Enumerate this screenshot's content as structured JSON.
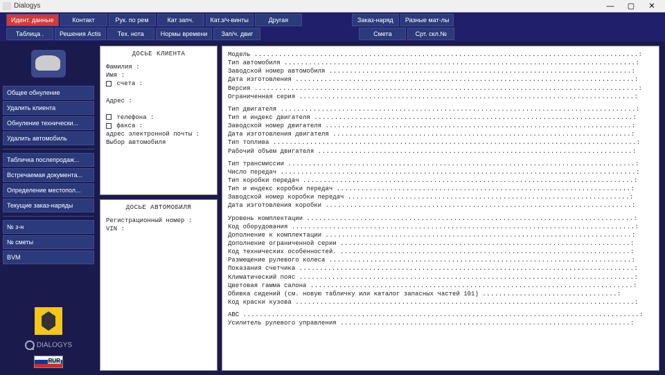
{
  "window": {
    "title": "Dialogys"
  },
  "topnav": {
    "row1": [
      "Идент. данные",
      "Контакт",
      "Рук. по рем",
      "Кат запч.",
      "Кат.з/ч-винты",
      "Другая",
      "",
      "Заказ-наряд",
      "Разные мат-лы"
    ],
    "row2": [
      "Таблица .",
      "Решения Actis",
      "Тех. нота",
      "Нормы времени",
      "Зап/ч. двиг",
      "",
      "",
      "Смета",
      "Срт. скл.№"
    ],
    "active_index": 0
  },
  "sidebar": {
    "group1": [
      "Общее обнуление",
      "Удалить клиента",
      "Обнуление технически...",
      "Удалить автомобиль"
    ],
    "group2": [
      "Табличка послепродаж...",
      "Встречаемая документа...",
      "Определение местопол...",
      "Текущие заказ-наряды"
    ],
    "group3": [
      "№ з-н",
      "№ сметы",
      "BVM"
    ],
    "brand": "DIALOGYS",
    "currency_label": "RUR"
  },
  "client_panel": {
    "title": "ДОСЬЕ КЛИЕНТА",
    "rows": [
      "Фамилия :",
      "Имя :",
      "□ счета :",
      "",
      "Адрес :",
      "",
      "□ телефона :",
      "□ факса :",
      "адрес электронной почты :",
      "      Выбор автомобиля"
    ]
  },
  "auto_panel": {
    "title": "ДОСЬЕ АВТОМОБИЛЯ",
    "rows": [
      "Регистрационный номер :",
      "VIN :"
    ]
  },
  "details": {
    "groups": [
      [
        "Модель",
        "Тип автомобиля",
        "Заводской номер автомобиля",
        "Дата изготовления",
        "Версия",
        "Ограниченная серия"
      ],
      [
        "Тип двигателя",
        "Тип и индекс двигателя",
        "Заводской номер двигателя",
        "Дата изготовления двигателя",
        "Тип топлива",
        "Рабочий объем двигателя"
      ],
      [
        "Тип трансмиссии",
        "Число передач",
        "Тип коробки передач",
        "Тип и индекс коробки передач",
        "Заводской номер коробки передач",
        "Дата изготовления коробки"
      ],
      [
        "Уровень комплектации",
        "Код оборудования",
        "Дополнение к комплектации",
        "Дополнение ограниченной серии",
        "Код технических особенностей.",
        "Размещение рулевого колеса",
        "Показания счетчика",
        "Климатический пояс",
        "Цветовая гамма салона",
        "Обивка сидений (см. новую табличку или каталог запасных частей 101)",
        "Код краски кузова"
      ],
      [
        "ABC",
        "Усилитель рулевого управления"
      ]
    ]
  }
}
